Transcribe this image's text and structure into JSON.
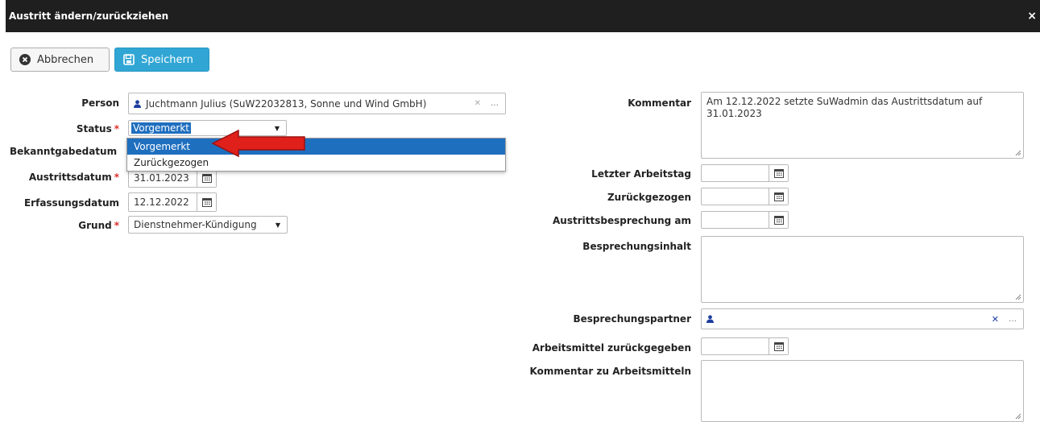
{
  "dialog": {
    "title": "Austritt ändern/zurückziehen",
    "close_glyph": "×"
  },
  "toolbar": {
    "cancel_label": "Abbrechen",
    "save_label": "Speichern"
  },
  "left": {
    "person_label": "Person",
    "person_value": "Juchtmann Julius (SuW22032813, Sonne und Wind GmbH)",
    "status_label": "Status",
    "status_value": "Vorgemerkt",
    "status_options": [
      "Vorgemerkt",
      "Zurückgezogen"
    ],
    "bekanntgabe_label": "Bekanntgabedatum",
    "austritt_label": "Austrittsdatum",
    "austritt_value": "31.01.2023",
    "erfassung_label": "Erfassungsdatum",
    "erfassung_value": "12.12.2022",
    "grund_label": "Grund",
    "grund_value": "Dienstnehmer-Kündigung",
    "required_mark": "*"
  },
  "right": {
    "kommentar_label": "Kommentar",
    "kommentar_value": "Am 12.12.2022 setzte SuWadmin das Austrittsdatum auf 31.01.2023",
    "letzter_label": "Letzter Arbeitstag",
    "zurueck_label": "Zurückgezogen",
    "besprechung_am_label": "Austrittsbesprechung am",
    "besprechungsinhalt_label": "Besprechungsinhalt",
    "besprechungspartner_label": "Besprechungspartner",
    "arbeitsmittel_label": "Arbeitsmittel zurückgegeben",
    "kommentar_arbeitsmittel_label": "Kommentar zu Arbeitsmitteln"
  },
  "colors": {
    "titlebar": "#1f1f1f",
    "save_button": "#31a6d4",
    "selected_option": "#1f6fbf",
    "required": "#d9302c",
    "annotation_arrow": "#e0201b"
  },
  "icons": {
    "cancel": "times-circle-icon",
    "save": "floppy-disk-icon",
    "user": "user-icon",
    "calendar": "calendar-icon"
  }
}
